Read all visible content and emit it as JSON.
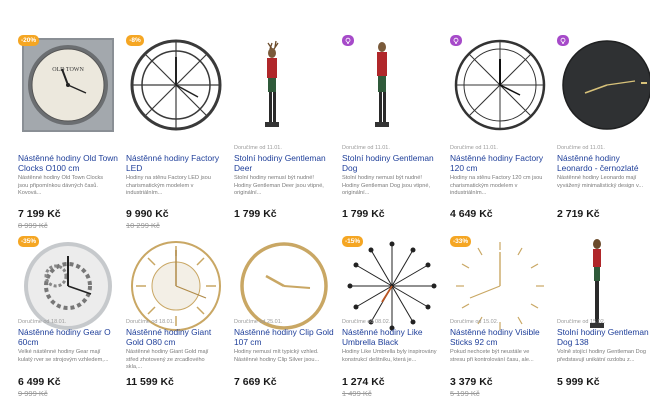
{
  "products": [
    {
      "badge": "-20%",
      "badge_type": "orange",
      "delivery": "",
      "title": "Nástěnné hodiny Old Town Clocks O100 cm",
      "desc": "Nástěnné hodiny Old Town Clocks jsou připomínkou dávných časů. Kovová...",
      "price": "7 199 Kč",
      "old_price": "8 999 Kč"
    },
    {
      "badge": "-8%",
      "badge_type": "orange",
      "delivery": "",
      "title": "Nástěnné hodiny Factory LED",
      "desc": "Hodiny na stěnu Factory LED jsou charismatickým modelem v industriálním...",
      "price": "9 990 Kč",
      "old_price": "10 299 Kč"
    },
    {
      "badge": "",
      "badge_type": "",
      "delivery": "Doručíme od 11.01.",
      "title": "Stolní hodiny Gentleman Deer",
      "desc": "Stolní hodiny nemusí být nudné! Hodiny Gentleman Deer jsou vtipné, originální...",
      "price": "1 799 Kč",
      "old_price": ""
    },
    {
      "badge": "",
      "badge_type": "purple",
      "delivery": "Doručíme od 11.01.",
      "title": "Stolní hodiny Gentleman Dog",
      "desc": "Stolní hodiny nemusí být nudné! Hodiny Gentleman Dog jsou vtipné, originální...",
      "price": "1 799 Kč",
      "old_price": ""
    },
    {
      "badge": "",
      "badge_type": "purple",
      "delivery": "Doručíme od 11.01.",
      "title": "Nástěnné hodiny Factory 120 cm",
      "desc": "Hodiny na stěnu Factory 120 cm jsou charismatickým modelem v industriálním...",
      "price": "4 649 Kč",
      "old_price": ""
    },
    {
      "badge": "",
      "badge_type": "purple",
      "delivery": "Doručíme od 11.01.",
      "title": "Nástěnné hodiny Leonardo - černozlaté",
      "desc": "Nástěnné hodiny Leonardo mají vyvážený minimalistický design v...",
      "price": "2 719 Kč",
      "old_price": ""
    },
    {
      "badge": "-35%",
      "badge_type": "orange",
      "delivery": "Doručíme od 18.01.",
      "title": "Nástěnné hodiny Gear O 60cm",
      "desc": "Velké nástěnné hodiny Gear mají kulatý rver se strojovým vzhledem,...",
      "price": "6 499 Kč",
      "old_price": "9 999 Kč"
    },
    {
      "badge": "",
      "badge_type": "",
      "delivery": "Doručíme od 18.01.",
      "title": "Nástěnné hodiny Giant Gold O80 cm",
      "desc": "Nástěnné hodiny Giant Gold mají střed zhotovený ze zrcadlového skla,...",
      "price": "11 599 Kč",
      "old_price": ""
    },
    {
      "badge": "",
      "badge_type": "",
      "delivery": "Doručíme od 25.01.",
      "title": "Nástěnné hodiny Clip Gold 107 cm",
      "desc": "Hodiny nemusí mít typický vzhled. Nástěnné hodiny Clip Silver jsou...",
      "price": "7 669 Kč",
      "old_price": ""
    },
    {
      "badge": "-15%",
      "badge_type": "orange",
      "delivery": "Doručíme od 08.02.",
      "title": "Nástěnné hodiny Like Umbrella Black",
      "desc": "Hodiny Like Umbrella byly inspirovány konstrukcí deštníku, která je...",
      "price": "1 274 Kč",
      "old_price": "1 499 Kč"
    },
    {
      "badge": "-33%",
      "badge_type": "orange",
      "delivery": "Doručíme od 15.02.",
      "title": "Nástěnné hodiny Visible Sticks 92 cm",
      "desc": "Pokud nechcete být neustále ve stresu při kontrolování času, ale...",
      "price": "3 379 Kč",
      "old_price": "5 199 Kč"
    },
    {
      "badge": "",
      "badge_type": "",
      "delivery": "Doručíme od 15.02.",
      "title": "Stolní hodiny Gentleman Dog 138",
      "desc": "Volně stojící hodiny Gentleman Dog představují unikátní ozdobu z...",
      "price": "5 999 Kč",
      "old_price": ""
    }
  ]
}
